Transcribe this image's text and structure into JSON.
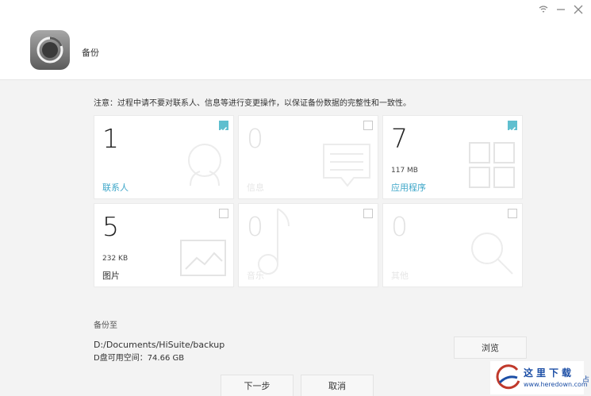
{
  "window": {
    "controls": [
      "wifi-icon",
      "minimize-icon",
      "close-icon"
    ]
  },
  "header": {
    "title": "备份",
    "logo_icon": "backup-dial-icon"
  },
  "notice": "注意：过程中请不要对联系人、信息等进行变更操作，以保证备份数据的完整性和一致性。",
  "categories": [
    {
      "count": "1",
      "size": "",
      "label": "联系人",
      "checked": true,
      "enabled": true,
      "icon": "contact-icon"
    },
    {
      "count": "0",
      "size": "",
      "label": "信息",
      "checked": false,
      "enabled": false,
      "icon": "message-icon"
    },
    {
      "count": "7",
      "size": "117 MB",
      "label": "应用程序",
      "checked": true,
      "enabled": true,
      "icon": "apps-grid-icon"
    },
    {
      "count": "5",
      "size": "232 KB",
      "label": "图片",
      "checked": false,
      "enabled": true,
      "icon": "picture-icon"
    },
    {
      "count": "0",
      "size": "",
      "label": "音乐",
      "checked": false,
      "enabled": false,
      "icon": "music-note-icon"
    },
    {
      "count": "0",
      "size": "",
      "label": "其他",
      "checked": false,
      "enabled": false,
      "icon": "search-icon"
    }
  ],
  "destination": {
    "label": "备份至",
    "path": "D:/Documents/HiSuite/backup",
    "space": "D盘可用空间：74.66 GB",
    "browse_label": "浏览"
  },
  "footer": {
    "next_label": "下一步",
    "cancel_label": "取消"
  },
  "watermark": {
    "text": "这里下载",
    "url": "www.heredown.com",
    "extra": "占"
  },
  "colors": {
    "accent": "#3fa7c9",
    "check": "#5fbfcf",
    "watermark": "#1d4fa6"
  }
}
